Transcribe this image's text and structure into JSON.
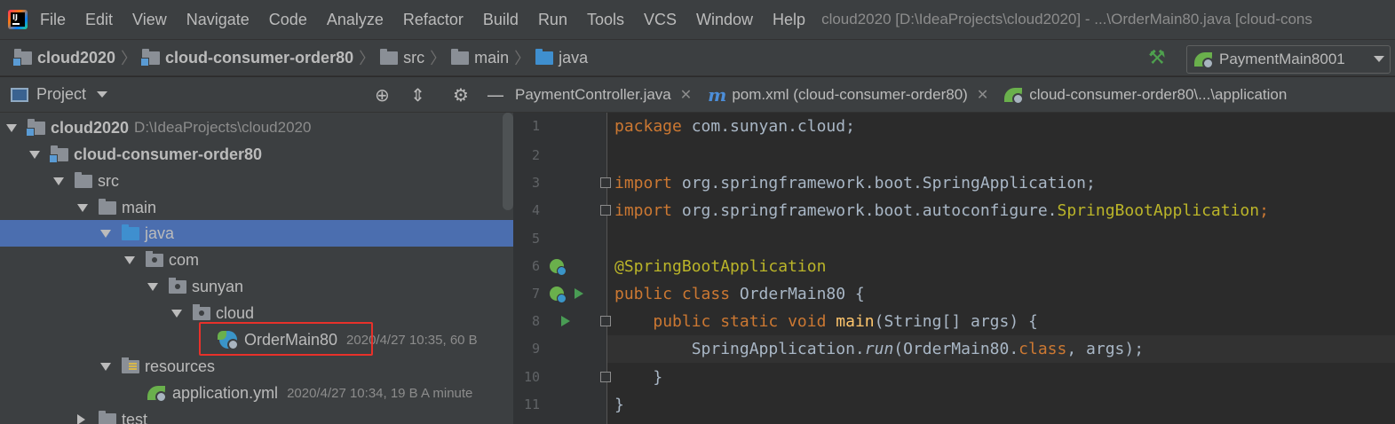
{
  "menubar": {
    "logo_text": "IJ",
    "items": [
      "File",
      "Edit",
      "View",
      "Navigate",
      "Code",
      "Analyze",
      "Refactor",
      "Build",
      "Run",
      "Tools",
      "VCS",
      "Window",
      "Help"
    ],
    "window_title": "cloud2020 [D:\\IdeaProjects\\cloud2020] - ...\\OrderMain80.java [cloud-cons"
  },
  "navbar": {
    "crumbs": [
      "cloud2020",
      "cloud-consumer-order80",
      "src",
      "main",
      "java"
    ],
    "run_config": "PaymentMain8001"
  },
  "project_panel": {
    "title": "Project",
    "tree": [
      {
        "label": "cloud2020",
        "meta": "D:\\IdeaProjects\\cloud2020"
      },
      {
        "label": "cloud-consumer-order80"
      },
      {
        "label": "src"
      },
      {
        "label": "main"
      },
      {
        "label": "java"
      },
      {
        "label": "com"
      },
      {
        "label": "sunyan"
      },
      {
        "label": "cloud"
      },
      {
        "label": "OrderMain80",
        "meta": "2020/4/27 10:35, 60 B"
      },
      {
        "label": "resources"
      },
      {
        "label": "application.yml",
        "meta": "2020/4/27 10:34, 19 B A minute"
      },
      {
        "label": "test"
      }
    ]
  },
  "editor": {
    "tabs": [
      {
        "label": "PaymentController.java"
      },
      {
        "label": "pom.xml (cloud-consumer-order80)"
      },
      {
        "label": "cloud-consumer-order80\\...\\application"
      }
    ],
    "line_numbers": [
      "1",
      "2",
      "3",
      "4",
      "5",
      "6",
      "7",
      "8",
      "9",
      "10",
      "11"
    ],
    "code": {
      "l1_kw": "package",
      "l1_rest": " com.sunyan.cloud;",
      "l3_kw": "import",
      "l3_rest": " org.springframework.boot.SpringApplication;",
      "l4_kw": "import",
      "l4_pre": " org.springframework.boot.autoconfigure.",
      "l4_cls": "SpringBootApplication",
      "l4_end": ";",
      "l6_ann": "@SpringBootApplication",
      "l7_kw": "public class",
      "l7_rest": " OrderMain80 {",
      "l8_indent": "    ",
      "l8_kw": "public static void",
      "l8_fn": " main",
      "l8_rest": "(String[] args) {",
      "l9_pre": "        SpringApplication.",
      "l9_it": "run",
      "l9_mid": "(OrderMain80.",
      "l9_kw": "class",
      "l9_end": ", args);",
      "l10": "    }",
      "l11": "}"
    }
  }
}
